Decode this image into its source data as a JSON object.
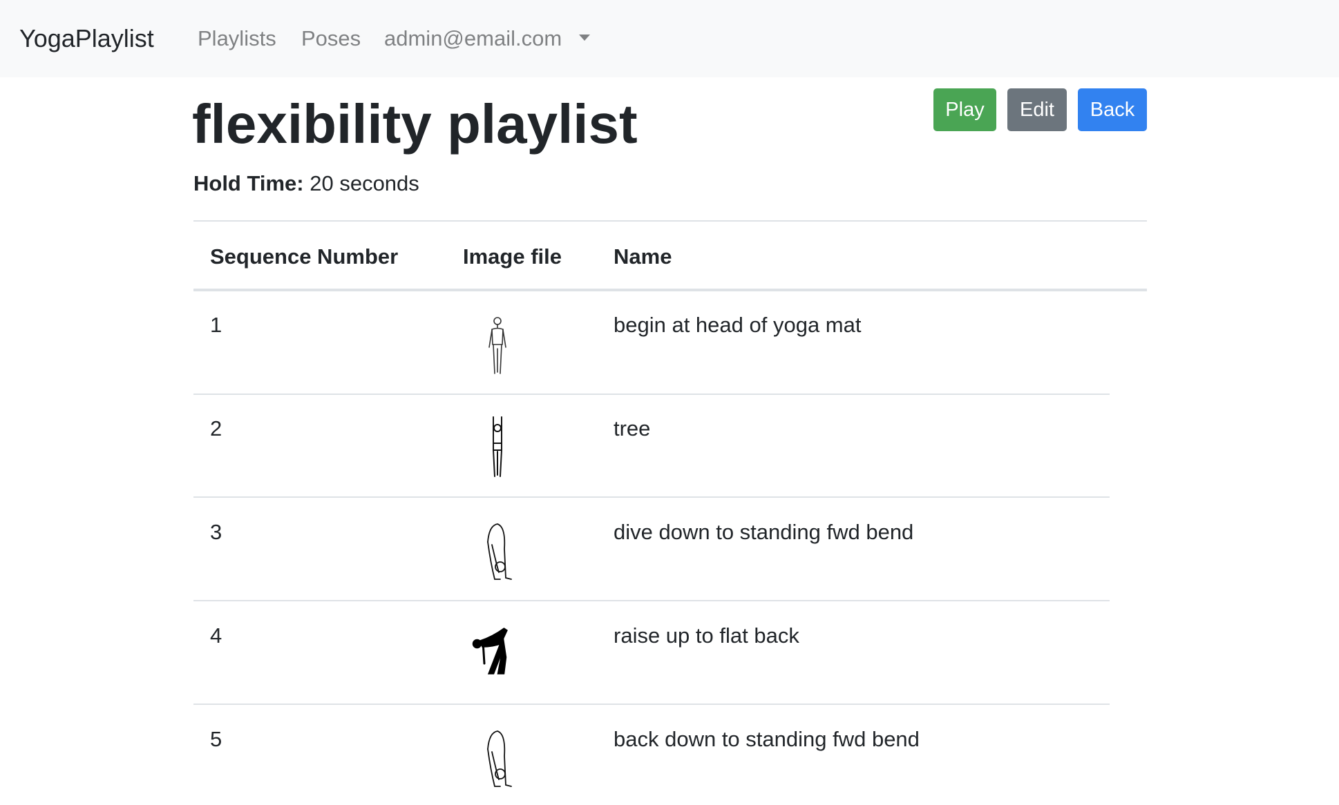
{
  "navbar": {
    "brand": "YogaPlaylist",
    "links": [
      "Playlists",
      "Poses"
    ],
    "user": "admin@email.com"
  },
  "playlist": {
    "title": "flexibility playlist",
    "hold_label": "Hold Time:",
    "hold_value": "20 seconds"
  },
  "buttons": {
    "play": "Play",
    "edit": "Edit",
    "back": "Back"
  },
  "colors": {
    "play": "#4aa554",
    "edit": "#6c757d",
    "back": "#3282f0"
  },
  "table": {
    "headers": [
      "Sequence Number",
      "Image file",
      "Name"
    ],
    "rows": [
      {
        "seq": "1",
        "icon": "mountain-pose-icon",
        "name": "begin at head of yoga mat"
      },
      {
        "seq": "2",
        "icon": "tree-pose-icon",
        "name": "tree"
      },
      {
        "seq": "3",
        "icon": "forward-bend-icon",
        "name": "dive down to standing fwd bend"
      },
      {
        "seq": "4",
        "icon": "flat-back-icon",
        "name": "raise up to flat back"
      },
      {
        "seq": "5",
        "icon": "forward-bend-icon",
        "name": "back down to standing fwd bend"
      }
    ]
  }
}
